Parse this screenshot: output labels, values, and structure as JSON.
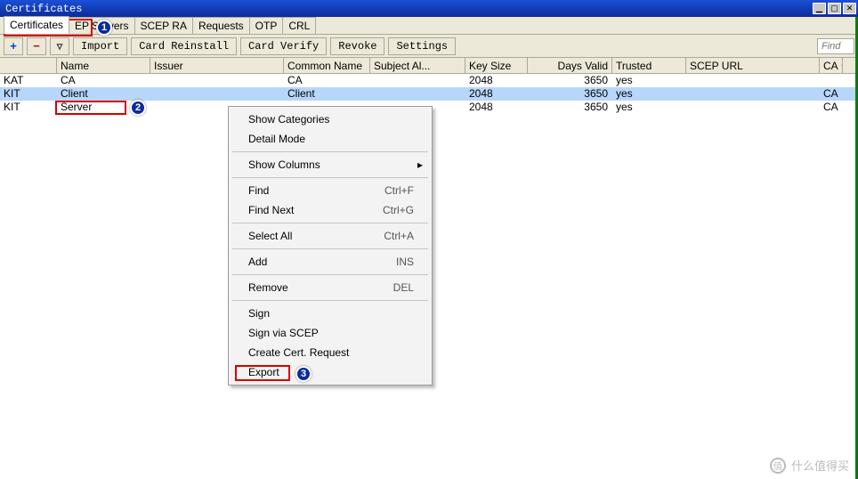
{
  "window": {
    "title": "Certificates"
  },
  "tabs": [
    {
      "label": "Certificates",
      "active": true
    },
    {
      "label": "EP Servers"
    },
    {
      "label": "SCEP RA"
    },
    {
      "label": "Requests"
    },
    {
      "label": "OTP"
    },
    {
      "label": "CRL"
    }
  ],
  "toolbar": {
    "import": "Import",
    "card_reinstall": "Card Reinstall",
    "card_verify": "Card Verify",
    "revoke": "Revoke",
    "settings": "Settings",
    "find_placeholder": "Find"
  },
  "columns": [
    "",
    "Name",
    "Issuer",
    "Common Name",
    "Subject Al...",
    "Key Size",
    "Days Valid",
    "Trusted",
    "SCEP URL",
    "CA"
  ],
  "rows": [
    {
      "c0": "KAT",
      "c1": "CA",
      "c2": "",
      "c3": "CA",
      "c4": "",
      "c5": "2048",
      "c6": "3650",
      "c7": "yes",
      "c8": "",
      "c9": ""
    },
    {
      "c0": "KIT",
      "c1": "Client",
      "c2": "",
      "c3": "Client",
      "c4": "",
      "c5": "2048",
      "c6": "3650",
      "c7": "yes",
      "c8": "",
      "c9": "CA",
      "selected": true
    },
    {
      "c0": "KIT",
      "c1": "Server",
      "c2": "",
      "c3": "",
      "c4": "",
      "c5": "2048",
      "c6": "3650",
      "c7": "yes",
      "c8": "",
      "c9": "CA"
    }
  ],
  "context_menu": {
    "groups": [
      [
        {
          "label": "Show Categories"
        },
        {
          "label": "Detail Mode"
        }
      ],
      [
        {
          "label": "Show Columns",
          "submenu": true
        }
      ],
      [
        {
          "label": "Find",
          "accel": "Ctrl+F"
        },
        {
          "label": "Find Next",
          "accel": "Ctrl+G"
        }
      ],
      [
        {
          "label": "Select All",
          "accel": "Ctrl+A"
        }
      ],
      [
        {
          "label": "Add",
          "accel": "INS"
        }
      ],
      [
        {
          "label": "Remove",
          "accel": "DEL"
        }
      ],
      [
        {
          "label": "Sign"
        },
        {
          "label": "Sign via SCEP"
        },
        {
          "label": "Create Cert. Request"
        },
        {
          "label": "Export"
        }
      ]
    ]
  },
  "annotations": {
    "badge1": "1",
    "badge2": "2",
    "badge3": "3"
  },
  "watermark": "什么值得买"
}
